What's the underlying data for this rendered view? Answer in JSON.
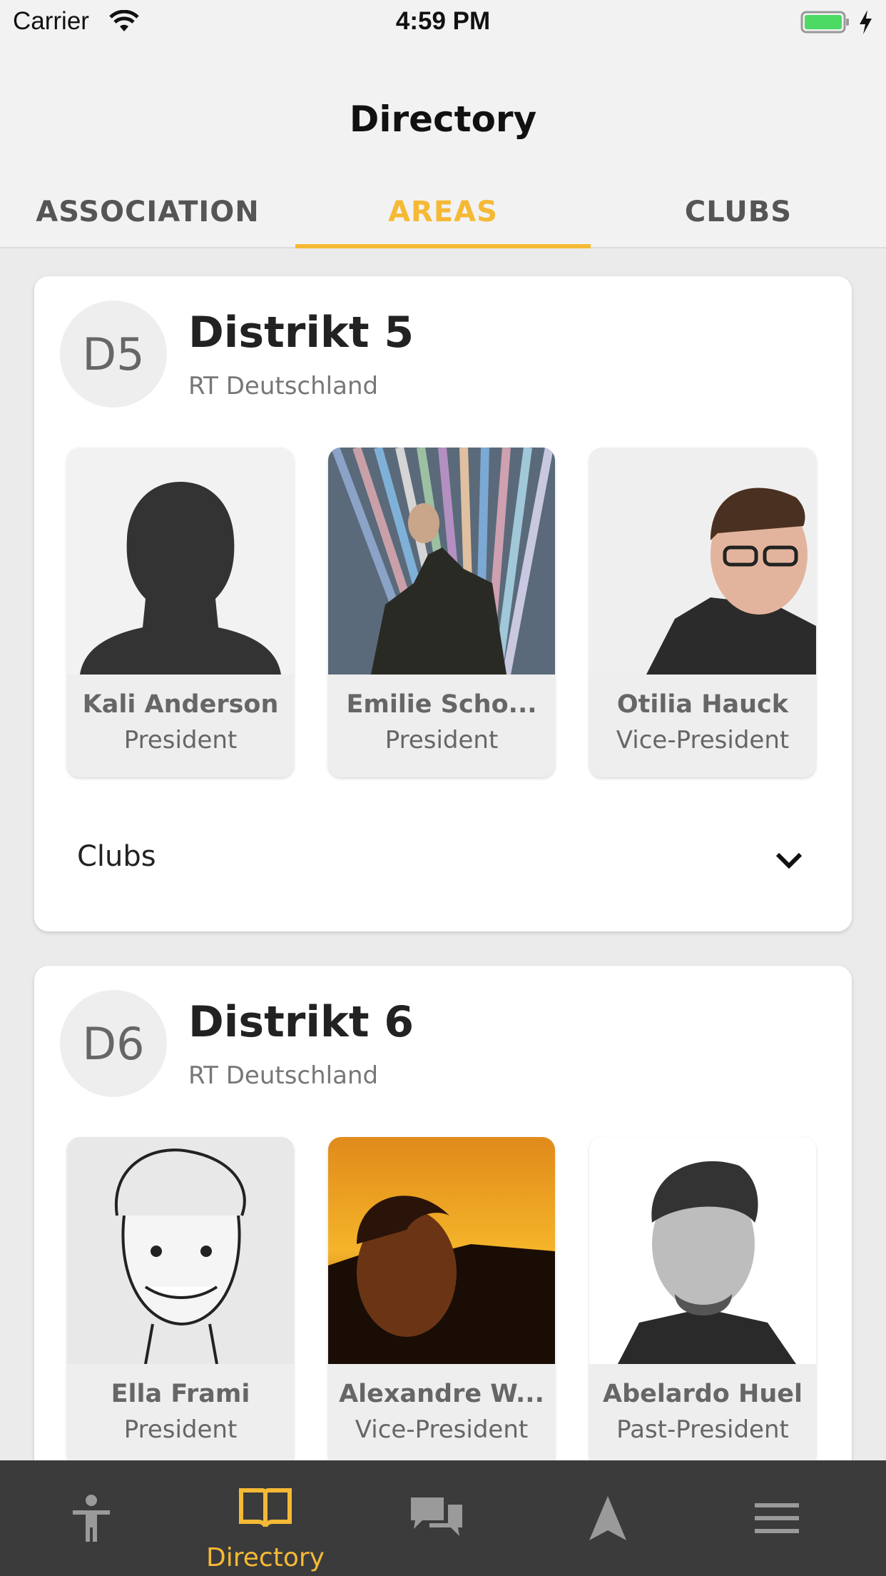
{
  "status_bar": {
    "carrier": "Carrier",
    "time": "4:59 PM"
  },
  "header": {
    "title": "Directory"
  },
  "tabs": [
    {
      "label": "ASSOCIATION",
      "active": false
    },
    {
      "label": "AREAS",
      "active": true
    },
    {
      "label": "CLUBS",
      "active": false
    }
  ],
  "areas": [
    {
      "badge": "D5",
      "title": "Distrikt 5",
      "subtitle": "RT Deutschland",
      "members": [
        {
          "name": "Kali Anderson",
          "role": "President",
          "photo": "silhouette-placeholder"
        },
        {
          "name": "Emilie Scho...",
          "role": "President",
          "photo": "man-under-colored-pillars"
        },
        {
          "name": "Otilia Hauck",
          "role": "Vice-President",
          "photo": "man-with-glasses"
        }
      ],
      "clubs_label": "Clubs"
    },
    {
      "badge": "D6",
      "title": "Distrikt 6",
      "subtitle": "RT Deutschland",
      "members": [
        {
          "name": "Ella Frami",
          "role": "President",
          "photo": "caricature-sketch"
        },
        {
          "name": "Alexandre W...",
          "role": "Vice-President",
          "photo": "man-at-sunset"
        },
        {
          "name": "Abelardo Huel",
          "role": "Past-President",
          "photo": "man-bw-portrait"
        }
      ]
    }
  ],
  "tabbar": {
    "items": [
      {
        "icon": "person-icon",
        "label": ""
      },
      {
        "icon": "book-icon",
        "label": "Directory"
      },
      {
        "icon": "chat-icon",
        "label": ""
      },
      {
        "icon": "navigation-arrow-icon",
        "label": ""
      },
      {
        "icon": "menu-icon",
        "label": ""
      }
    ],
    "active_color": "#f5b935",
    "inactive_color": "#9a9a9a"
  },
  "colors": {
    "accent": "#f5b935",
    "battery": "#4cd964"
  }
}
